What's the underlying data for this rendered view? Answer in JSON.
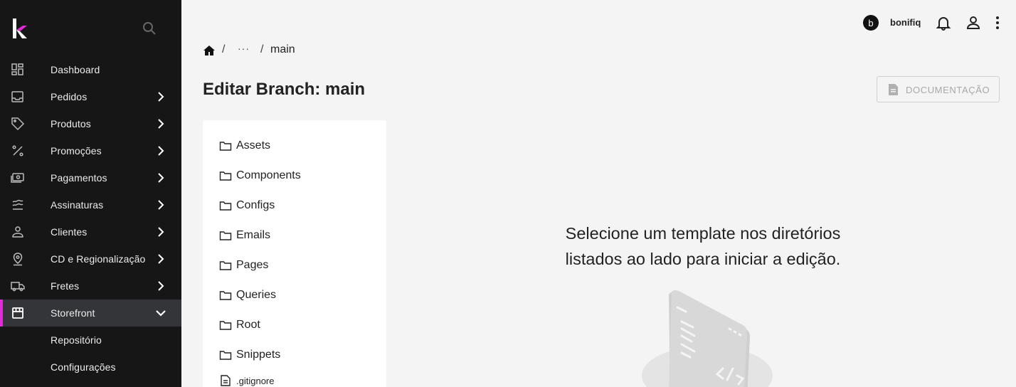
{
  "sidebar": {
    "logo": "k-logo-icon",
    "items": [
      {
        "label": "Dashboard",
        "icon": "dashboard-icon",
        "has_children": false
      },
      {
        "label": "Pedidos",
        "icon": "inbox-icon",
        "has_children": true
      },
      {
        "label": "Produtos",
        "icon": "tag-icon",
        "has_children": true
      },
      {
        "label": "Promoções",
        "icon": "percent-icon",
        "has_children": true
      },
      {
        "label": "Pagamentos",
        "icon": "money-icon",
        "has_children": true
      },
      {
        "label": "Assinaturas",
        "icon": "waves-icon",
        "has_children": true
      },
      {
        "label": "Clientes",
        "icon": "person-icon",
        "has_children": true
      },
      {
        "label": "CD e Regionalização",
        "icon": "location-icon",
        "has_children": true
      },
      {
        "label": "Fretes",
        "icon": "truck-icon",
        "has_children": true
      },
      {
        "label": "Storefront",
        "icon": "store-icon",
        "has_children": true,
        "expanded": true
      }
    ],
    "subitems": [
      {
        "label": "Repositório"
      },
      {
        "label": "Configurações"
      }
    ]
  },
  "topbar": {
    "avatar_letter": "b",
    "username": "bonifiq"
  },
  "breadcrumb": {
    "sep": "/",
    "ellipsis": "···",
    "current": "main"
  },
  "page": {
    "title": "Editar Branch: main",
    "doc_button": "DOCUMENTAÇÃO"
  },
  "tree": {
    "folders": [
      "Assets",
      "Components",
      "Configs",
      "Emails",
      "Pages",
      "Queries",
      "Root",
      "Snippets"
    ],
    "files": [
      ".gitignore"
    ]
  },
  "empty_state": {
    "line1": "Selecione um template nos diretórios",
    "line2": "listados ao lado para iniciar a edição."
  },
  "colors": {
    "sidebar_bg": "#161616",
    "accent": "#e02bd6",
    "page_bg": "#f4f4f4"
  }
}
